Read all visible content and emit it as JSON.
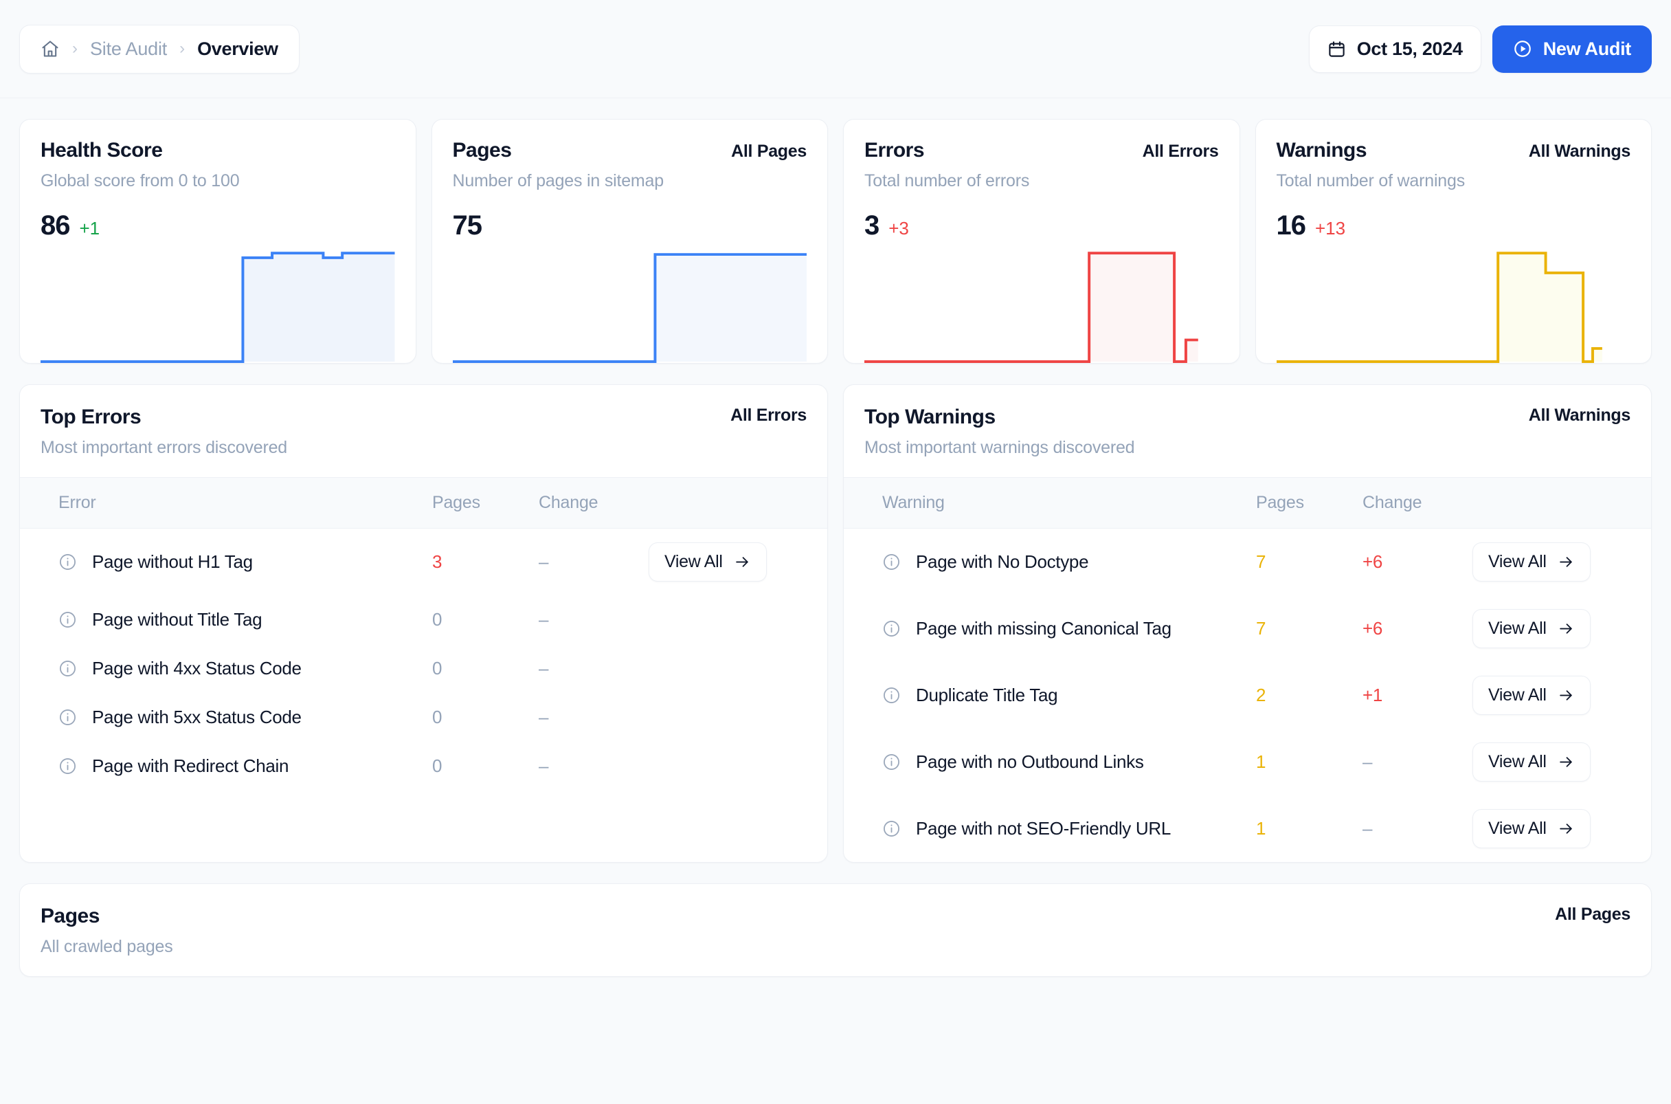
{
  "header": {
    "breadcrumb": {
      "home_icon": "home-icon",
      "separator": "›",
      "parent": "Site Audit",
      "current": "Overview"
    },
    "date_button": {
      "icon": "calendar-icon",
      "label": "Oct 15, 2024"
    },
    "new_audit_button": {
      "icon": "play-circle-icon",
      "label": "New Audit"
    },
    "accent_color": "#2563eb"
  },
  "stats": [
    {
      "title": "Health Score",
      "link": "",
      "subtitle": "Global score from 0 to 100",
      "value": "86",
      "delta": "+1",
      "delta_kind": "up",
      "color": "#3b82f6",
      "fill": "#eff4fc"
    },
    {
      "title": "Pages",
      "link": "All Pages",
      "subtitle": "Number of pages in sitemap",
      "value": "75",
      "delta": "",
      "delta_kind": "none",
      "color": "#3b82f6",
      "fill": "#f3f7fd"
    },
    {
      "title": "Errors",
      "link": "All Errors",
      "subtitle": "Total number of errors",
      "value": "3",
      "delta": "+3",
      "delta_kind": "bad",
      "color": "#ef4444",
      "fill": "#fdf5f5"
    },
    {
      "title": "Warnings",
      "link": "All Warnings",
      "subtitle": "Total number of warnings",
      "value": "16",
      "delta": "+13",
      "delta_kind": "bad",
      "color": "#eab308",
      "fill": "#fdfdef"
    }
  ],
  "chart_data": [
    {
      "type": "area",
      "title": "Health Score",
      "ylabel": "Health Score",
      "ylim": [
        0,
        100
      ],
      "grid": false,
      "x": [
        0,
        1,
        2,
        3,
        4,
        5,
        6,
        7,
        8,
        9,
        10,
        11
      ],
      "values": [
        0,
        0,
        0,
        0,
        0,
        0,
        0,
        85,
        85,
        85,
        88,
        86,
        88
      ]
    },
    {
      "type": "area",
      "title": "Pages",
      "ylabel": "Pages",
      "ylim": [
        0,
        80
      ],
      "grid": false,
      "x": [
        0,
        1,
        2,
        3,
        4,
        5,
        6,
        7,
        8,
        9,
        10,
        11
      ],
      "values": [
        0,
        0,
        0,
        0,
        0,
        0,
        0,
        75,
        75,
        75,
        75,
        75,
        75
      ]
    },
    {
      "type": "area",
      "title": "Errors",
      "ylabel": "Errors",
      "ylim": [
        0,
        4
      ],
      "grid": false,
      "x": [
        0,
        1,
        2,
        3,
        4,
        5,
        6,
        7,
        8,
        9,
        10,
        11
      ],
      "values": [
        0,
        0,
        0,
        0,
        0,
        0,
        0,
        3,
        3,
        3,
        3,
        0,
        0.35
      ]
    },
    {
      "type": "area",
      "title": "Warnings",
      "ylabel": "Warnings",
      "ylim": [
        0,
        18
      ],
      "grid": false,
      "x": [
        0,
        1,
        2,
        3,
        4,
        5,
        6,
        7,
        8,
        9,
        10,
        11
      ],
      "values": [
        0,
        0,
        0,
        0,
        0,
        0,
        0,
        16,
        16,
        13,
        13,
        0,
        1
      ]
    }
  ],
  "top_errors": {
    "title": "Top Errors",
    "subtitle": "Most important errors discovered",
    "link": "All Errors",
    "columns": [
      "Error",
      "Pages",
      "Change"
    ],
    "rows": [
      {
        "icon": "info-icon",
        "label": "Page without H1 Tag",
        "pages": "3",
        "pages_kind": "red",
        "change": "–",
        "change_kind": "dash",
        "action": "View All",
        "show_action": true
      },
      {
        "icon": "info-icon",
        "label": "Page without Title Tag",
        "pages": "0",
        "pages_kind": "zero",
        "change": "–",
        "change_kind": "dash",
        "action": "View All",
        "show_action": false
      },
      {
        "icon": "info-icon",
        "label": "Page with 4xx Status Code",
        "pages": "0",
        "pages_kind": "zero",
        "change": "–",
        "change_kind": "dash",
        "action": "View All",
        "show_action": false
      },
      {
        "icon": "info-icon",
        "label": "Page with 5xx Status Code",
        "pages": "0",
        "pages_kind": "zero",
        "change": "–",
        "change_kind": "dash",
        "action": "View All",
        "show_action": false
      },
      {
        "icon": "info-icon",
        "label": "Page with Redirect Chain",
        "pages": "0",
        "pages_kind": "zero",
        "change": "–",
        "change_kind": "dash",
        "action": "View All",
        "show_action": false
      }
    ]
  },
  "top_warnings": {
    "title": "Top Warnings",
    "subtitle": "Most important warnings discovered",
    "link": "All Warnings",
    "columns": [
      "Warning",
      "Pages",
      "Change"
    ],
    "rows": [
      {
        "icon": "info-icon",
        "label": "Page with No Doctype",
        "pages": "7",
        "pages_kind": "amber",
        "change": "+6",
        "change_kind": "bad",
        "action": "View All",
        "show_action": true
      },
      {
        "icon": "info-icon",
        "label": "Page with missing Canonical Tag",
        "pages": "7",
        "pages_kind": "amber",
        "change": "+6",
        "change_kind": "bad",
        "action": "View All",
        "show_action": true
      },
      {
        "icon": "info-icon",
        "label": "Duplicate Title Tag",
        "pages": "2",
        "pages_kind": "amber",
        "change": "+1",
        "change_kind": "bad",
        "action": "View All",
        "show_action": true
      },
      {
        "icon": "info-icon",
        "label": "Page with no Outbound Links",
        "pages": "1",
        "pages_kind": "amber",
        "change": "–",
        "change_kind": "dash",
        "action": "View All",
        "show_action": true
      },
      {
        "icon": "info-icon",
        "label": "Page with not SEO-Friendly URL",
        "pages": "1",
        "pages_kind": "amber",
        "change": "–",
        "change_kind": "dash",
        "action": "View All",
        "show_action": true
      }
    ]
  },
  "pages_panel": {
    "title": "Pages",
    "subtitle": "All crawled pages",
    "link": "All Pages"
  }
}
